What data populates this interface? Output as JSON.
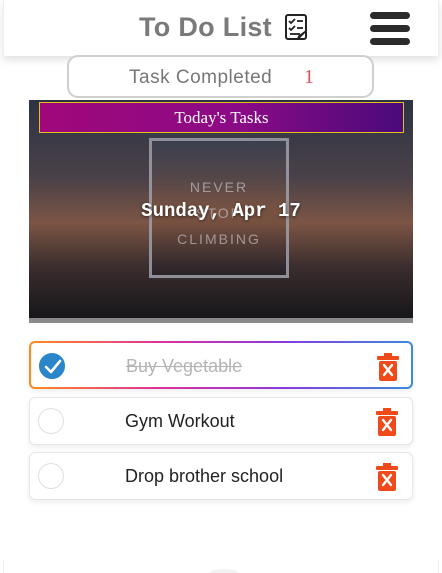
{
  "header": {
    "title": "To Do List",
    "title_icon": "checklist-icon",
    "menu_icon": "hamburger-menu-icon"
  },
  "stats": {
    "label": "Task Completed",
    "count": "1"
  },
  "banner": {
    "title": "Today's Tasks",
    "date": "Sunday, Apr 17",
    "poster_lines": [
      "NEVER",
      "STOP",
      "CLIMBING"
    ]
  },
  "tasks": [
    {
      "text": "Buy Vegetable",
      "completed": true
    },
    {
      "text": "Gym Workout",
      "completed": false
    },
    {
      "text": "Drop brother school",
      "completed": false
    }
  ],
  "colors": {
    "accent_blue": "#2a86c8",
    "delete_orange": "#f04a1a",
    "count_red": "#e0505a",
    "banner_title_gradient": [
      "#a0087a",
      "#4a0a7a"
    ]
  }
}
